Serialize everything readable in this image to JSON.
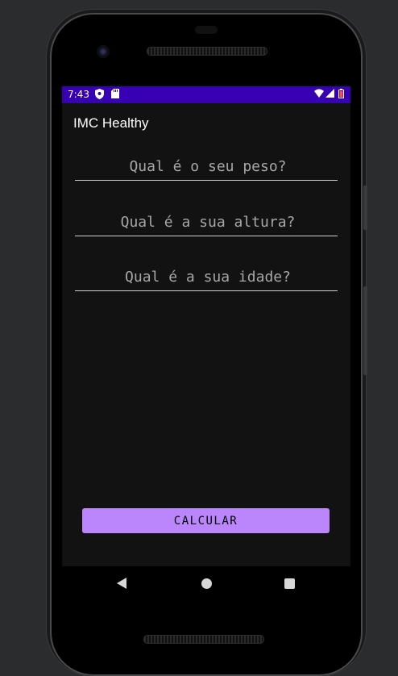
{
  "statusbar": {
    "time": "7:43",
    "icons_left": [
      "shield-icon",
      "sd-card-icon"
    ],
    "icons_right": [
      "wifi-icon",
      "signal-icon",
      "battery-icon"
    ],
    "color": "#3700b3"
  },
  "app": {
    "title": "IMC Healthy"
  },
  "form": {
    "weight_placeholder": "Qual é o seu peso?",
    "height_placeholder": "Qual é a sua altura?",
    "age_placeholder": "Qual é a sua idade?"
  },
  "actions": {
    "calculate_label": "CALCULAR",
    "button_color": "#bb86fc"
  },
  "navbar": {
    "items": [
      "back-icon",
      "home-icon",
      "recents-icon"
    ]
  }
}
